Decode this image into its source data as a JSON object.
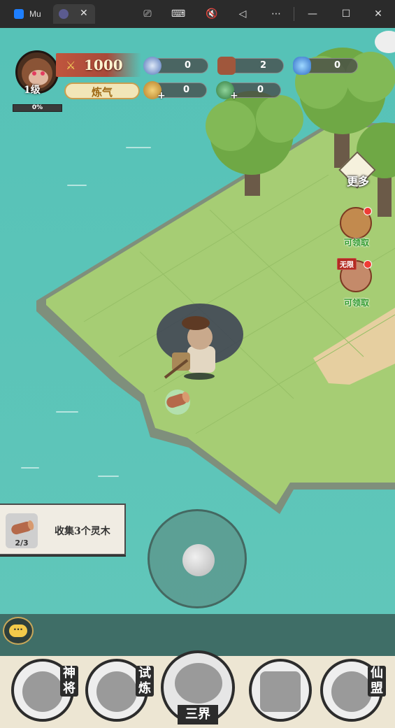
{
  "window": {
    "tab1_label": "Mu",
    "close_glyph": "✕"
  },
  "player": {
    "level_label": "1级",
    "xp_percent": "0%",
    "power_value": "1000",
    "realm": "炼气"
  },
  "resources": {
    "spirit_orb": "0",
    "wood": "2",
    "crystal": "0",
    "coin": "0",
    "refresh": "0"
  },
  "side_menu": {
    "more_label": "更多",
    "gift_claim": "可领取",
    "unlimited_tag": "无限",
    "unlimited_claim": "可领取"
  },
  "quest": {
    "progress": "2/3",
    "text": "收集3个灵木"
  },
  "bottom_nav": {
    "heroes": "神将",
    "trials": "试炼",
    "three_realms": "三界",
    "alliance": "仙盟"
  },
  "colors": {
    "water": "#5cc4b8",
    "grass": "#a6cd74",
    "bottom_dark": "#3f6e67"
  }
}
